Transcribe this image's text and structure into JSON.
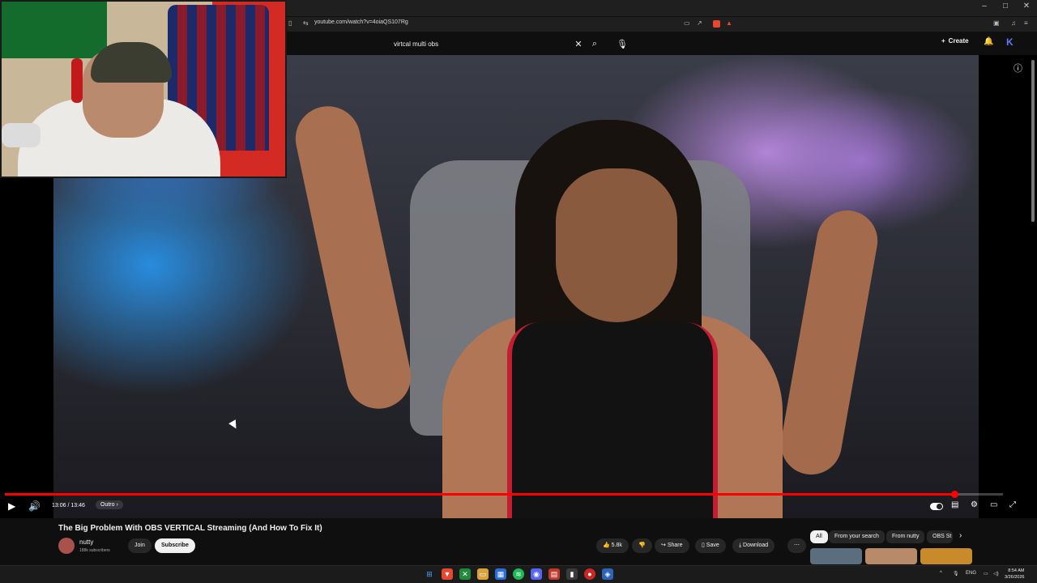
{
  "browser": {
    "url": "youtube.com/watch?v=4oiaQS107Rg",
    "window_controls": [
      "–",
      "□",
      "✕"
    ]
  },
  "header": {
    "search_value": "virtcal multi obs",
    "create_label": "Create",
    "avatar_letter": "K"
  },
  "player": {
    "time_display": "13:06 / 13:46",
    "chapter_label": "Outro",
    "progress": 0.951
  },
  "video": {
    "title": "The Big Problem With OBS VERTICAL Streaming (And How To Fix It)",
    "channel_name": "nutty",
    "subscribers": "188k subscribers",
    "join_label": "Join",
    "subscribe_label": "Subscribe",
    "like_count": "5.8k",
    "share_label": "Share",
    "save_label": "Save",
    "download_label": "Download"
  },
  "recommend_chips": [
    "All",
    "From your search",
    "From nutty",
    "OBS St"
  ],
  "taskbar": {
    "lang": "ENG",
    "time": "8:54 AM",
    "date": "3/26/2026"
  },
  "colors": {
    "accent_red": "#ff0000",
    "bg": "#0f0f0f",
    "pill_bg": "#272727"
  }
}
